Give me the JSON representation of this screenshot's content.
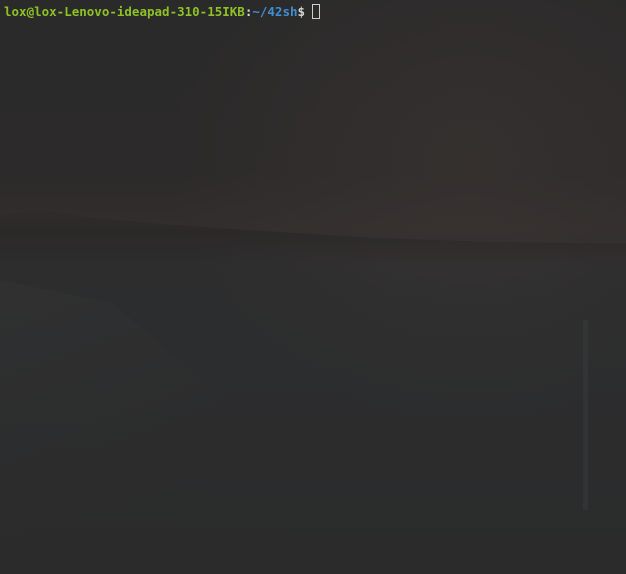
{
  "terminal": {
    "prompt": {
      "user_host": "lox@lox-Lenovo-ideapad-310-15IKB",
      "separator": ":",
      "path": "~/42sh",
      "symbol": "$"
    },
    "cursor": "block-outline",
    "colors": {
      "user_host": "#8ec125",
      "path": "#3f8fd2",
      "text": "#d6d6d6",
      "background": "#2b2b2b"
    }
  }
}
